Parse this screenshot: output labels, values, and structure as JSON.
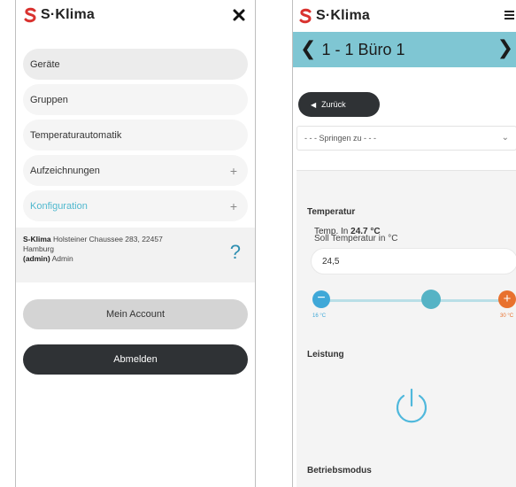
{
  "left": {
    "brand": "S·Klima",
    "menu": [
      {
        "label": "Geräte",
        "expand": ""
      },
      {
        "label": "Gruppen",
        "expand": ""
      },
      {
        "label": "Temperaturautomatik",
        "expand": ""
      },
      {
        "label": "Aufzeichnungen",
        "expand": "+"
      },
      {
        "label": "Konfiguration",
        "expand": "+"
      }
    ],
    "company": {
      "name": "S-Klima",
      "address": "Holsteiner Chaussee 283, 22457",
      "city": "Hamburg",
      "user_role": "(admin)",
      "user_name": "Admin"
    },
    "help_symbol": "?",
    "account_button": "Mein Account",
    "logout_button": "Abmelden"
  },
  "right": {
    "brand": "S·Klima",
    "room_title": "1 - 1 Büro 1",
    "back_button": "Zurück",
    "jump_select": "- - - Springen zu - - -",
    "temperature_heading": "Temperatur",
    "temp_in_label": "Temp. In",
    "temp_in_value": "24.7 °C",
    "soll_label": "Soll Temperatur in °C",
    "soll_value": "24,5",
    "slider": {
      "min_label": "16 °C",
      "max_label": "30 °C",
      "value_fraction": 0.6
    },
    "leistung_heading": "Leistung",
    "betriebsmodus_heading": "Betriebsmodus"
  },
  "colors": {
    "accent": "#7fc6d3",
    "dark_button": "#2f3235",
    "slider_minus": "#3fa8d8",
    "slider_plus": "#e8712e",
    "highlight_text": "#4fb8ce"
  }
}
